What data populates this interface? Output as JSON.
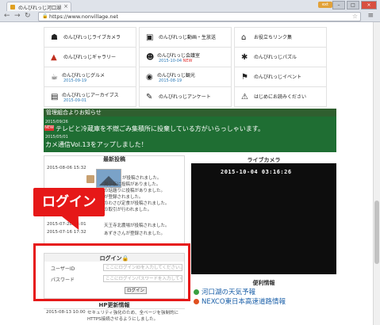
{
  "browser": {
    "tab_title": "のんびれっじ河口湖",
    "tab_close": "×",
    "url": "https://www.nonvillage.net",
    "extension_badge": "ext"
  },
  "menu": [
    {
      "label": "のんびれっじライブカメラ",
      "date": "",
      "icon": "camera-icon",
      "glyph": "☗"
    },
    {
      "label": "のんびれっじ動画・生放送",
      "date": "",
      "icon": "video-icon",
      "glyph": "▣"
    },
    {
      "label": "お役立ちリンク集",
      "date": "",
      "icon": "home-icon",
      "glyph": "⌂"
    },
    {
      "label": "のんびれっじギャラリー",
      "date": "",
      "icon": "mountain-icon",
      "glyph": "▲"
    },
    {
      "label": "のんびれっじ会議室",
      "date": "2015-10-04",
      "badge": "NEW",
      "icon": "people-icon",
      "glyph": "☻"
    },
    {
      "label": "のんびれっじパズル",
      "date": "",
      "icon": "puzzle-icon",
      "glyph": "✱"
    },
    {
      "label": "のんびれっじグルメ",
      "date": "2015-09-19",
      "icon": "gourmet-icon",
      "glyph": "☕"
    },
    {
      "label": "のんびれっじ観光",
      "date": "2015-08-19",
      "icon": "camera-tourism-icon",
      "glyph": "◉"
    },
    {
      "label": "のんびれっじイベント",
      "date": "",
      "icon": "flag-icon",
      "glyph": "⚑"
    },
    {
      "label": "のんびれっじアーカイブス",
      "date": "2015-09-01",
      "icon": "archive-icon",
      "glyph": "▤"
    },
    {
      "label": "のんびれっじアンケート",
      "date": "",
      "icon": "survey-icon",
      "glyph": "✎"
    },
    {
      "label": "はじめにお読みください",
      "date": "",
      "icon": "warning-icon",
      "glyph": "⚠"
    }
  ],
  "news": {
    "title": "管理組合よりお知らせ",
    "items": [
      {
        "date": "2015/09/26",
        "badge": "NEW",
        "text": "テレビと冷蔵庫を不燃ごみ集積所に投棄している方がいらっしゃいます。"
      },
      {
        "date": "2015/05/01",
        "text": "カメ通信Vol.13をアップしました！"
      }
    ]
  },
  "recent": {
    "title": "最新投稿",
    "rows": [
      {
        "date": "2015-08-06 15:32",
        "text": "が投稿されました。",
        "link": ""
      },
      {
        "date": "",
        "text": "掲示板に投稿がありました。",
        "link": ""
      },
      {
        "date": "",
        "text": "の話題りに投稿がありました。",
        "link": ""
      },
      {
        "date": "",
        "text": "が登録されました。",
        "link": ""
      },
      {
        "date": "",
        "text": "のわさび定食が投稿されました。",
        "link": ""
      },
      {
        "date": "",
        "text": "の取引が行われました。",
        "link": ""
      },
      {
        "date": "2015-07-28 23:01",
        "text": "天王寺北農場が投稿されました。",
        "link": ""
      },
      {
        "date": "2015-07-16 17:32",
        "text": "あずきさんが登録されました。",
        "link": ""
      }
    ]
  },
  "callout": {
    "text": "ログイン"
  },
  "login": {
    "title": "ログイン🔒",
    "user_label": "ユーザーID",
    "user_placeholder": "ここにログインIDを入力してください。",
    "pass_label": "パスワード",
    "pass_placeholder": "ここにログインパスワードを入力してくださ",
    "button": "ログイン"
  },
  "camera": {
    "title": "ライブカメラ",
    "timestamp": "2015-10-04  03:16:26"
  },
  "info": {
    "title": "便利情報",
    "items": [
      "河口湖の天気予報",
      "NEXCO東日本高速道路情報"
    ]
  },
  "hp_update": {
    "title": "HP更新情報",
    "date": "2015-08-13 10:00",
    "text": "セキュリティ強化のため、全ページを強制的にHTTPS接続させるようにしました。"
  },
  "colors": {
    "news_bg": "#1f6e33",
    "callout": "#e61818",
    "link": "#1a5fa8"
  }
}
